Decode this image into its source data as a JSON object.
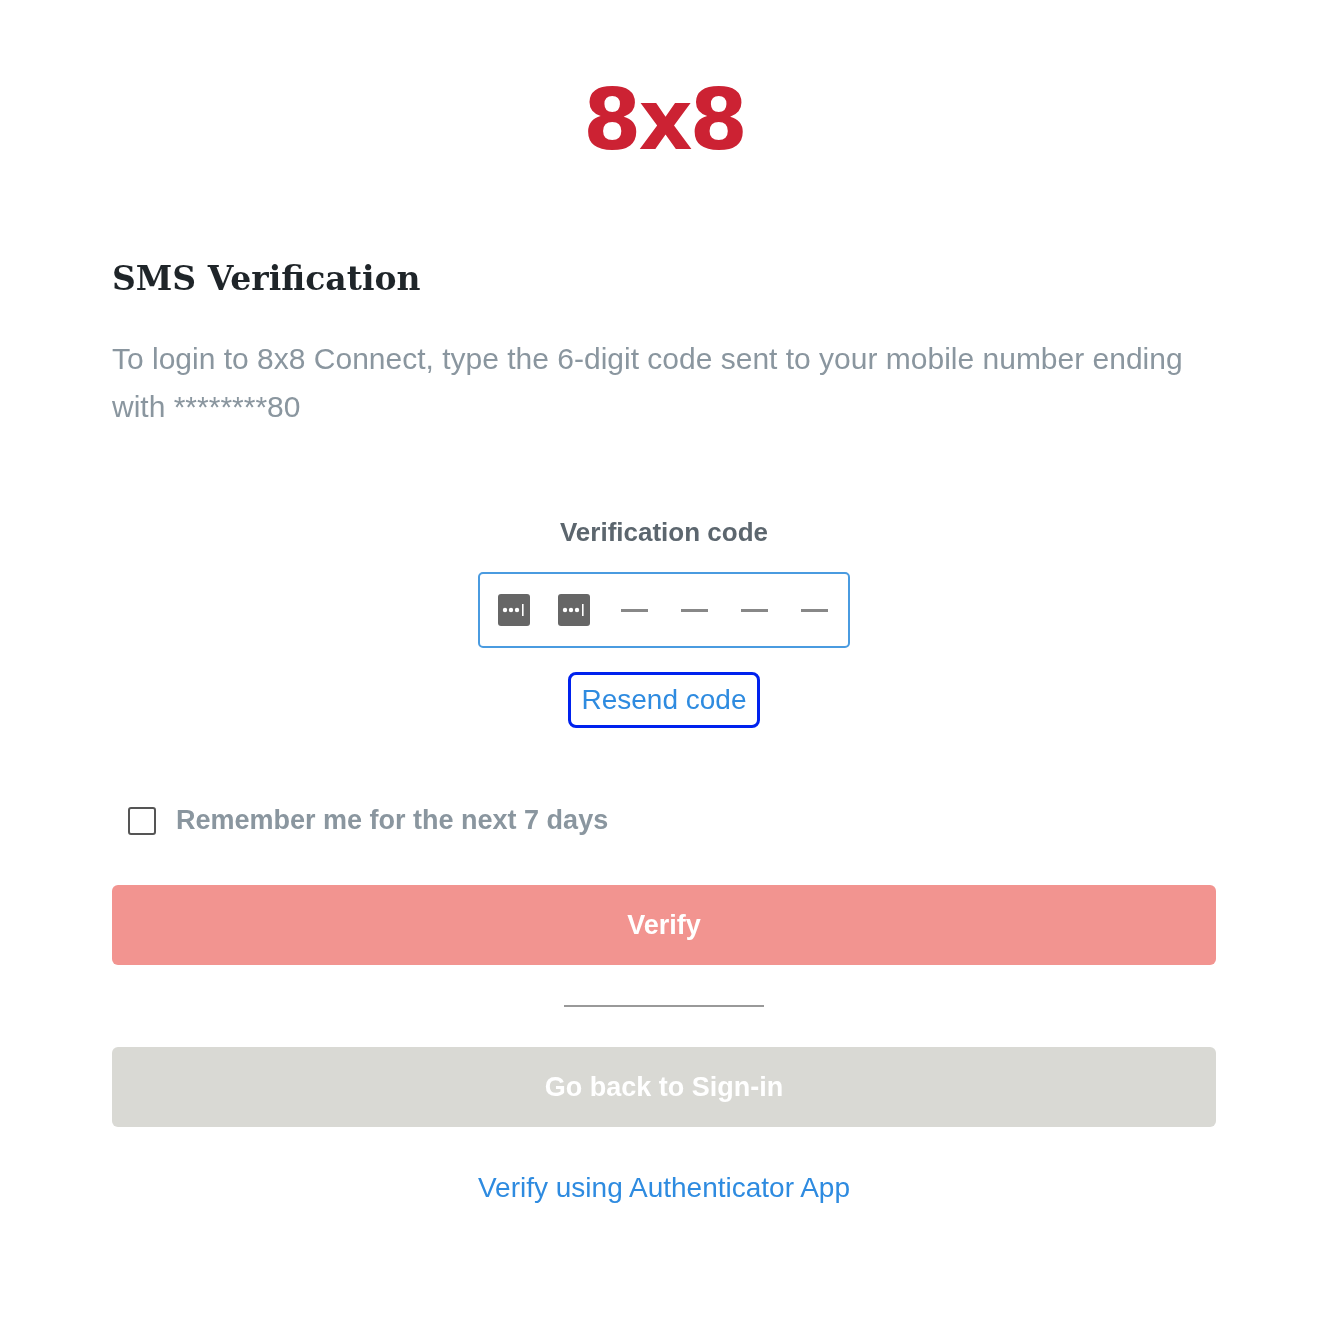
{
  "logo": "8x8",
  "heading": "SMS Verification",
  "instructions": "To login to 8x8 Connect, type the 6-digit code sent to your mobile number ending with ********80",
  "code_field": {
    "label": "Verification code",
    "slots": [
      {
        "kind": "autofill"
      },
      {
        "kind": "autofill"
      },
      {
        "kind": "blank"
      },
      {
        "kind": "blank"
      },
      {
        "kind": "blank"
      },
      {
        "kind": "blank"
      }
    ]
  },
  "resend": {
    "label": "Resend code",
    "focused": true
  },
  "remember": {
    "label": "Remember me for the next 7 days",
    "checked": false
  },
  "verify_button": {
    "label": "Verify",
    "disabled": true
  },
  "back_button": {
    "label": "Go back to Sign-in",
    "disabled": true
  },
  "alt_link": "Verify using Authenticator App"
}
